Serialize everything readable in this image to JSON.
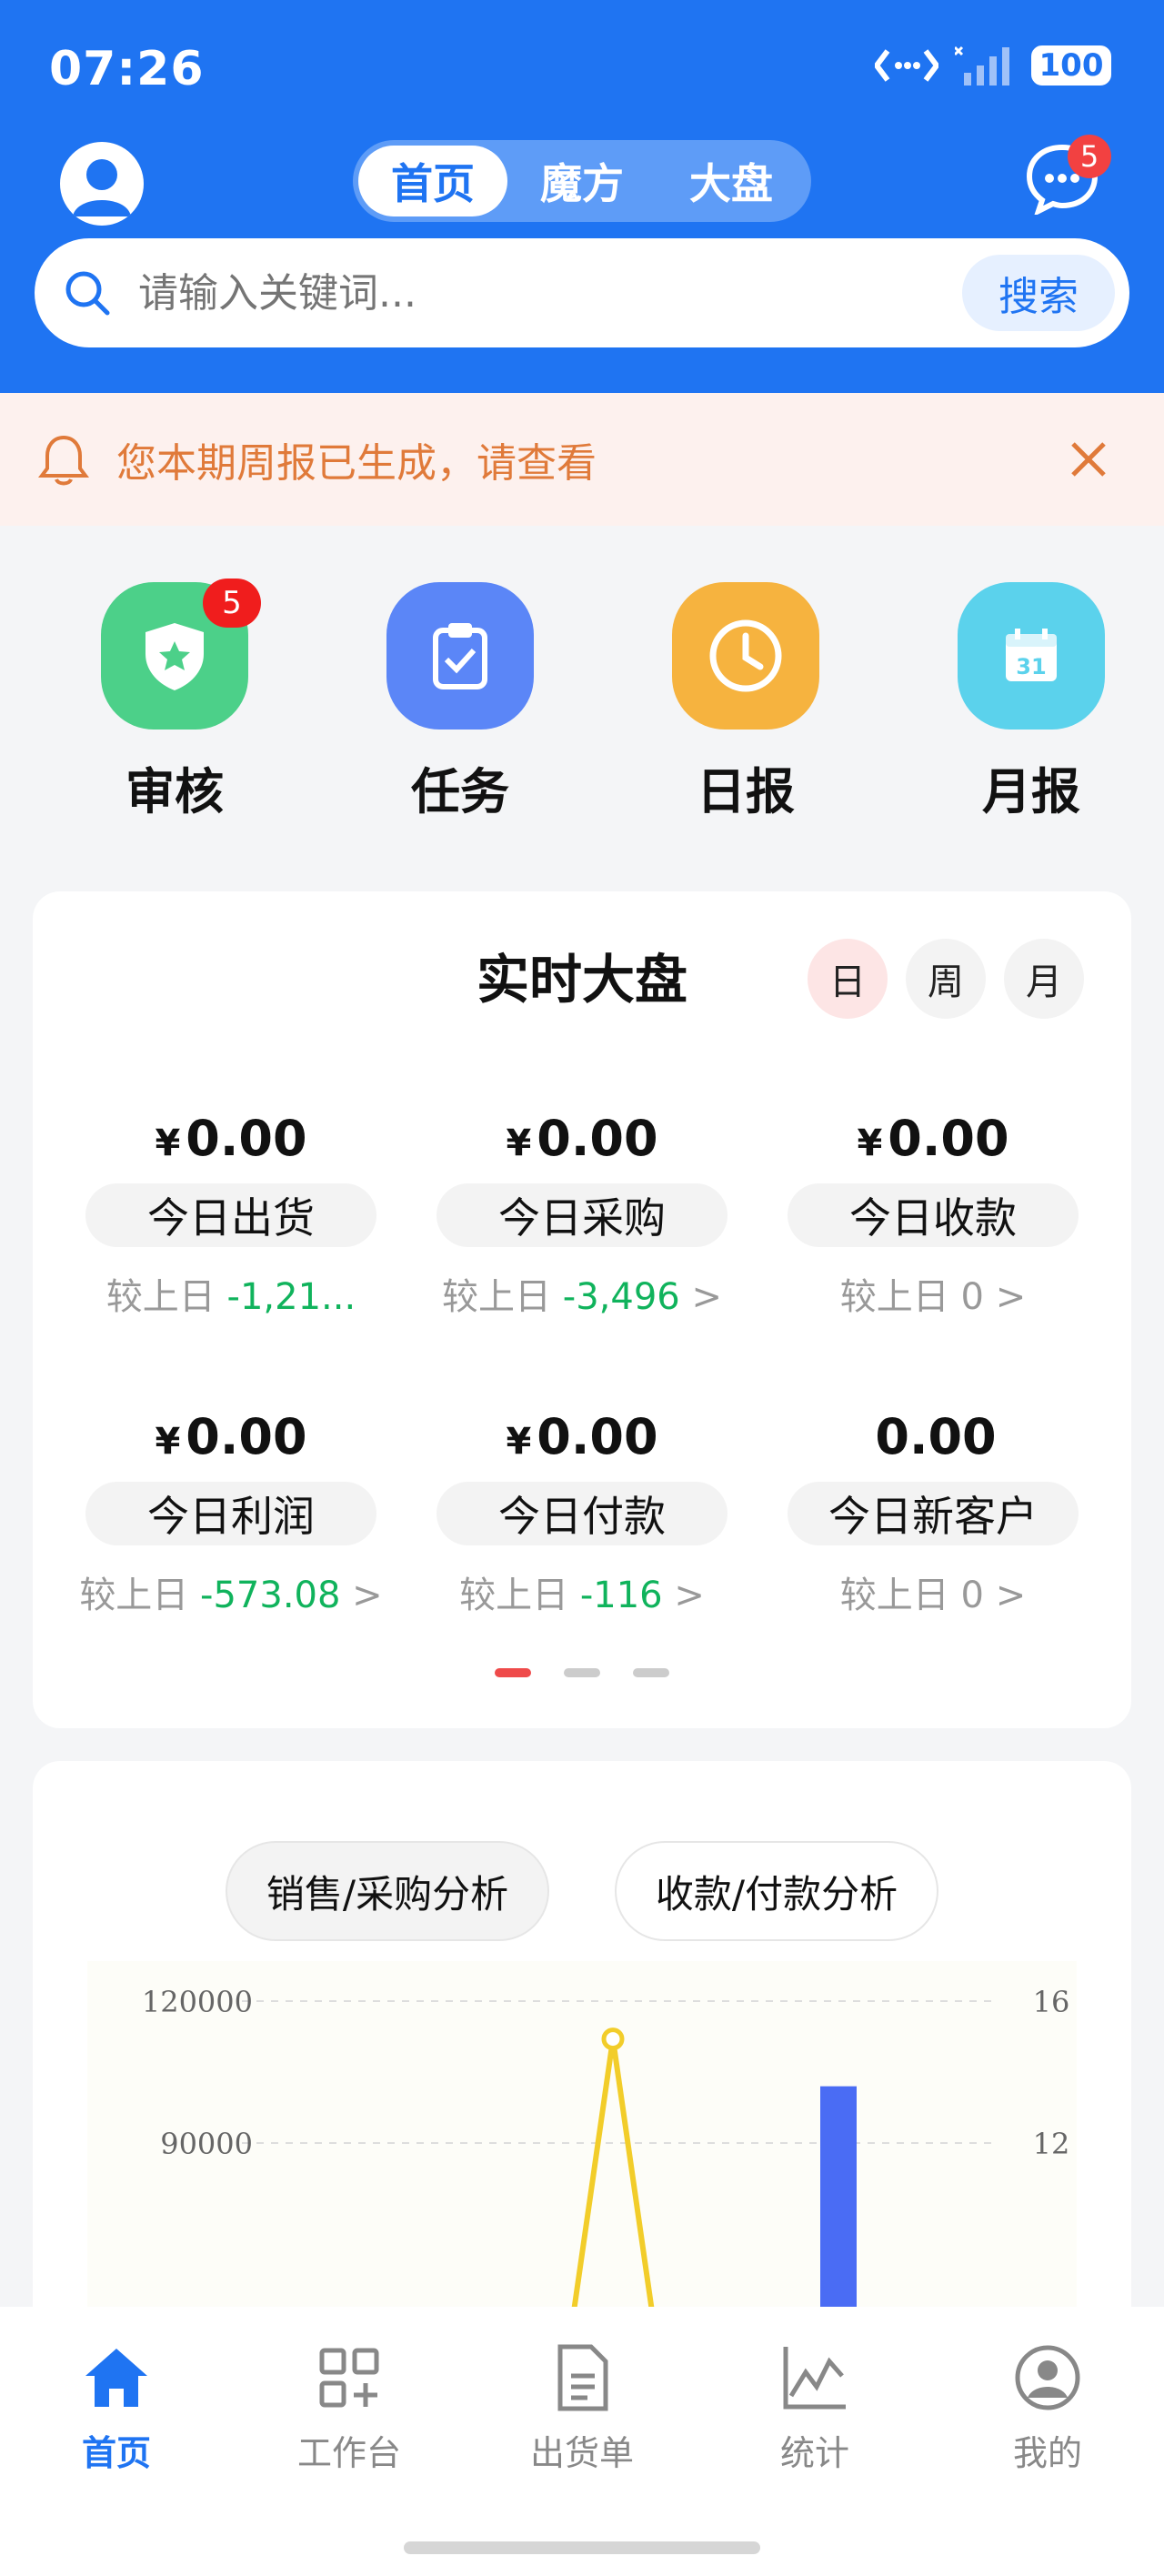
{
  "status": {
    "time": "07:26",
    "battery": "100"
  },
  "header": {
    "tabs": [
      {
        "label": "首页",
        "active": true
      },
      {
        "label": "魔方",
        "active": false
      },
      {
        "label": "大盘",
        "active": false
      }
    ],
    "message_badge": "5"
  },
  "search": {
    "placeholder": "请输入关键词...",
    "button": "搜索"
  },
  "notice": {
    "text": "您本期周报已生成，请查看"
  },
  "quick_menu": [
    {
      "label": "审核",
      "icon": "shield-star-icon",
      "color": "#4cd089",
      "badge": "5"
    },
    {
      "label": "任务",
      "icon": "clipboard-check-icon",
      "color": "#5b86f7",
      "badge": ""
    },
    {
      "label": "日报",
      "icon": "clock-icon",
      "color": "#f6b33f",
      "badge": ""
    },
    {
      "label": "月报",
      "icon": "calendar-icon",
      "color": "#5bd2ec",
      "badge": "",
      "calendar_day": "31"
    }
  ],
  "realtime": {
    "title": "实时大盘",
    "periods": [
      {
        "label": "日",
        "active": true
      },
      {
        "label": "周",
        "active": false
      },
      {
        "label": "月",
        "active": false
      }
    ],
    "metrics": [
      {
        "currency": "¥",
        "value": "0.00",
        "label": "今日出货",
        "compare_prefix": "较上日",
        "compare_value": "-1,21...",
        "arrow": ""
      },
      {
        "currency": "¥",
        "value": "0.00",
        "label": "今日采购",
        "compare_prefix": "较上日",
        "compare_value": "-3,496",
        "arrow": ">"
      },
      {
        "currency": "¥",
        "value": "0.00",
        "label": "今日收款",
        "compare_prefix": "较上日",
        "compare_value": "0",
        "arrow": ">"
      },
      {
        "currency": "¥",
        "value": "0.00",
        "label": "今日利润",
        "compare_prefix": "较上日",
        "compare_value": "-573.08",
        "arrow": ">"
      },
      {
        "currency": "¥",
        "value": "0.00",
        "label": "今日付款",
        "compare_prefix": "较上日",
        "compare_value": "-116",
        "arrow": ">"
      },
      {
        "currency": "",
        "value": "0.00",
        "label": "今日新客户",
        "compare_prefix": "较上日",
        "compare_value": "0",
        "arrow": ">"
      }
    ]
  },
  "analysis": {
    "tabs": [
      {
        "label": "销售/采购分析",
        "active": true
      },
      {
        "label": "收款/付款分析",
        "active": false
      }
    ]
  },
  "chart_data": {
    "type": "bar",
    "title": "",
    "y_left_ticks": [
      "120000",
      "90000"
    ],
    "y_right_ticks": [
      "16",
      "12"
    ],
    "y_left_range": [
      0,
      120000
    ],
    "y_right_range": [
      0,
      16
    ],
    "line_series": {
      "peak_value": 112000,
      "color": "#f2cd2a"
    },
    "bar_series": {
      "value": 102000,
      "color": "#4a6cf4"
    }
  },
  "tabbar": [
    {
      "label": "首页",
      "icon": "home-icon",
      "active": true
    },
    {
      "label": "工作台",
      "icon": "grid-plus-icon",
      "active": false
    },
    {
      "label": "出货单",
      "icon": "document-icon",
      "active": false
    },
    {
      "label": "统计",
      "icon": "chart-line-icon",
      "active": false
    },
    {
      "label": "我的",
      "icon": "user-circle-icon",
      "active": false
    }
  ]
}
